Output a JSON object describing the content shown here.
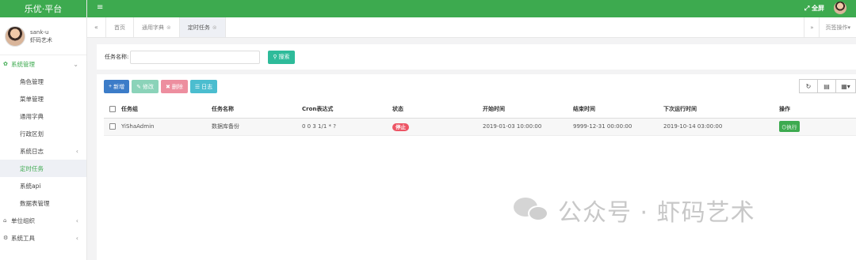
{
  "brand": {
    "title": "乐优·平台"
  },
  "profile": {
    "username": "sank-u",
    "org": "虾码艺术"
  },
  "sidebar": {
    "items": [
      {
        "label": "系统管理",
        "icon": "gear-icon",
        "type": "group",
        "open": true
      },
      {
        "label": "角色管理",
        "type": "sub"
      },
      {
        "label": "菜单管理",
        "type": "sub"
      },
      {
        "label": "通用字典",
        "type": "sub"
      },
      {
        "label": "行政区划",
        "type": "sub"
      },
      {
        "label": "系统日志",
        "type": "sub",
        "chevron": "‹"
      },
      {
        "label": "定时任务",
        "type": "sub",
        "active": true
      },
      {
        "label": "系统api",
        "type": "sub"
      },
      {
        "label": "数据表管理",
        "type": "sub"
      },
      {
        "label": "单位组织",
        "icon": "home-icon",
        "type": "group",
        "chevron": "‹"
      },
      {
        "label": "系统工具",
        "icon": "tools-icon",
        "type": "group",
        "chevron": "‹"
      }
    ]
  },
  "topbar": {
    "fullscreen_label": "全屏",
    "menu_icon": "≡"
  },
  "tabs": {
    "prev_icon": "«",
    "next_icon": "»",
    "items": [
      {
        "label": "首页",
        "closable": false
      },
      {
        "label": "通用字典",
        "closable": true
      },
      {
        "label": "定时任务",
        "closable": true,
        "active": true
      }
    ],
    "page_ops_label": "页签操作"
  },
  "search": {
    "label": "任务名称:",
    "value": "",
    "button_label": "搜索"
  },
  "toolbar": {
    "add_label": "新增",
    "edit_label": "修改",
    "delete_label": "删除",
    "log_label": "日志"
  },
  "table": {
    "headers": [
      "任务组",
      "任务名称",
      "Cron表达式",
      "状态",
      "开始时间",
      "结束时间",
      "下次运行时间",
      "操作"
    ],
    "rows": [
      {
        "group": "YiShaAdmin",
        "name": "数据库备份",
        "cron": "0 0 3 1/1 * ?",
        "status": "停止",
        "start": "2019-01-03 10:00:00",
        "end": "9999-12-31 00:00:00",
        "next": "2019-10-14 03:00:00",
        "action": "执行"
      }
    ]
  },
  "watermark": {
    "text": "公众号 · 虾码艺术"
  },
  "colors": {
    "brand": "#3daa4f",
    "search": "#2ebb9a",
    "add": "#3c7cc8",
    "stop": "#ed5565"
  }
}
